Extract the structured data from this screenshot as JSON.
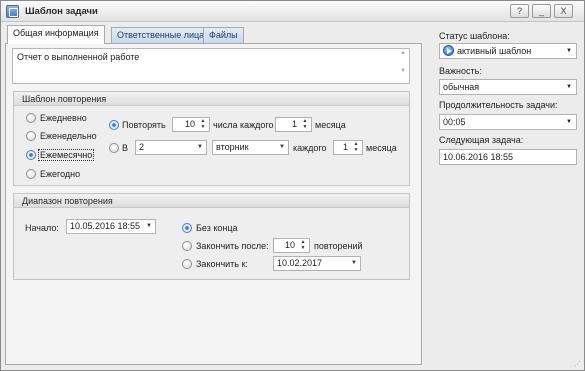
{
  "window": {
    "title": "Шаблон задачи",
    "help": "?",
    "minimize": "_",
    "close": "X"
  },
  "tabs": [
    "Общая информация",
    "Ответственные лица",
    "Файлы"
  ],
  "description": "Отчет о выполненной работе",
  "recurrence": {
    "title": "Шаблон повторения",
    "daily": "Ежедневно",
    "weekly": "Еженедельно",
    "monthly": "Ежемесячно",
    "yearly": "Ежегодно",
    "repeat_label": "Повторять",
    "repeat_day": "10",
    "day_of_every": "числа каждого",
    "repeat_months": "1",
    "months": "месяца",
    "in_label": "В",
    "ordinal": "2",
    "weekday": "вторник",
    "every": "каждого",
    "months2": "1",
    "months2_label": "месяца"
  },
  "range": {
    "title": "Диапазон повторения",
    "start_label": "Начало:",
    "start_value": "10.05.2016 18:55",
    "no_end": "Без конца",
    "end_after": "Закончить после:",
    "occurrences": "10",
    "occurrences_label": "повторений",
    "end_by": "Закончить к:",
    "end_date": "10.02.2017"
  },
  "side": {
    "status_label": "Статус шаблона:",
    "status_value": "активный шаблон",
    "importance_label": "Важность:",
    "importance_value": "обычная",
    "duration_label": "Продолжительность задачи:",
    "duration_value": "00:05",
    "next_label": "Следующая задача:",
    "next_value": "10.06.2016 18:55"
  },
  "colors": {
    "accent": "#3c7bd6",
    "tab_inactive": "#c9d9ec",
    "border": "#a9a9a9"
  }
}
